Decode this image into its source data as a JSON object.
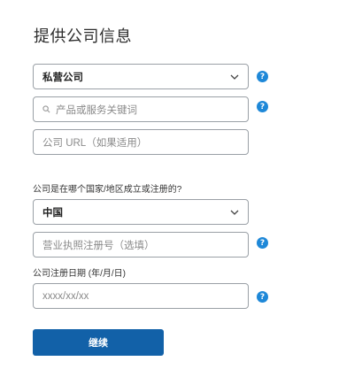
{
  "page": {
    "title": "提供公司信息"
  },
  "form": {
    "company_type": {
      "value": "私营公司"
    },
    "keywords": {
      "placeholder": "产品或服务关键词"
    },
    "company_url": {
      "placeholder": "公司 URL（如果适用）"
    },
    "country_question": "公司是在哪个国家/地区成立或注册的?",
    "country": {
      "value": "中国"
    },
    "license": {
      "placeholder": "营业执照注册号（选填）"
    },
    "reg_date_label": "公司注册日期 (年/月/日)",
    "reg_date": {
      "placeholder": "xxxx/xx/xx"
    },
    "help_glyph": "?",
    "continue_label": "继续"
  },
  "colors": {
    "accent": "#1e88d8",
    "button": "#1261a8",
    "border": "#9aa0a6"
  },
  "icons": {
    "select_arrow": "chevron-down-icon",
    "search": "search-icon",
    "help": "help-icon"
  }
}
